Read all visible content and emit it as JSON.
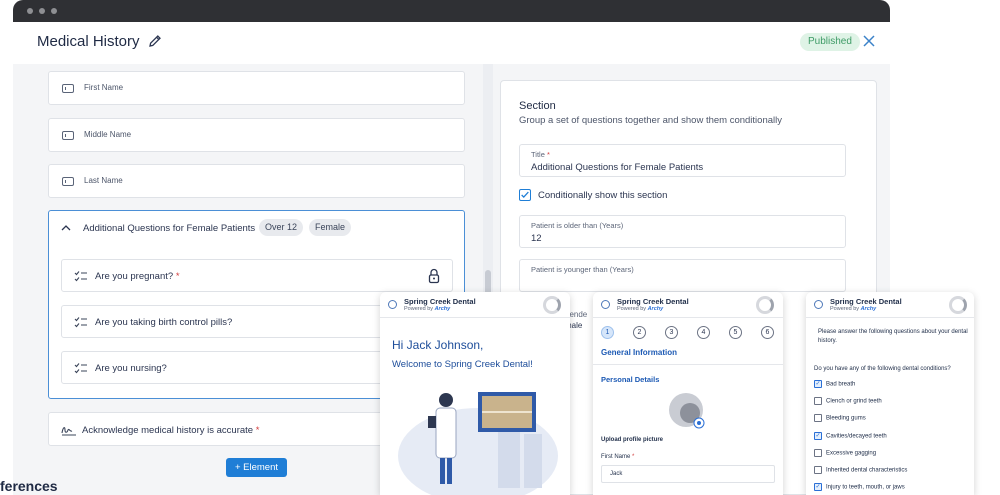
{
  "app": {
    "title": "Medical History",
    "status": "Published"
  },
  "form": {
    "fields": [
      "First Name",
      "Middle Name",
      "Last Name"
    ],
    "section": {
      "title": "Additional Questions for Female Patients",
      "chips": [
        "Over 12",
        "Female"
      ],
      "questions": [
        "Are you pregnant?",
        "Are you taking birth control pills?",
        "Are you nursing?"
      ]
    },
    "acknowledge": "Acknowledge medical history is accurate",
    "add_button": "+ Element"
  },
  "required_mark": "*",
  "inspector": {
    "heading": "Section",
    "subtitle": "Group a set of questions together and show them conditionally",
    "title_label": "Title",
    "title_value": "Additional Questions for Female Patients",
    "conditional_label": "Conditionally show this section",
    "older_label": "Patient is older than (Years)",
    "older_value": "12",
    "younger_label": "Patient is younger than (Years)",
    "gender_fragment": "gende",
    "female_fragment": "male"
  },
  "footer_text": "ferences",
  "previews": {
    "practice": "Spring Creek Dental",
    "powered": "Powered by",
    "brand": "Archy",
    "greeting": "Hi Jack Johnson,",
    "welcome": "Welcome to Spring Creek Dental!",
    "steps": [
      "1",
      "2",
      "3",
      "4",
      "5",
      "6"
    ],
    "general_info": "General Information",
    "personal_details": "Personal Details",
    "upload_label": "Upload profile picture",
    "first_name_label": "First Name",
    "first_name_value": "Jack",
    "dental_intro": "Please answer the following questions about your dental history.",
    "dental_question": "Do you have any of the following dental conditions?",
    "dental_options": [
      {
        "label": "Bad breath",
        "checked": true
      },
      {
        "label": "Clench or grind teeth",
        "checked": false
      },
      {
        "label": "Bleeding gums",
        "checked": false
      },
      {
        "label": "Cavities/decayed teeth",
        "checked": true
      },
      {
        "label": "Excessive gagging",
        "checked": false
      },
      {
        "label": "Inherited dental characteristics",
        "checked": false
      },
      {
        "label": "Injury to teeth, mouth, or jaws",
        "checked": true
      }
    ]
  },
  "colors": {
    "accent": "#1f7ed6",
    "published_bg": "#dff3e6",
    "published_text": "#3e9b66",
    "titlebar": "#2f3034"
  }
}
